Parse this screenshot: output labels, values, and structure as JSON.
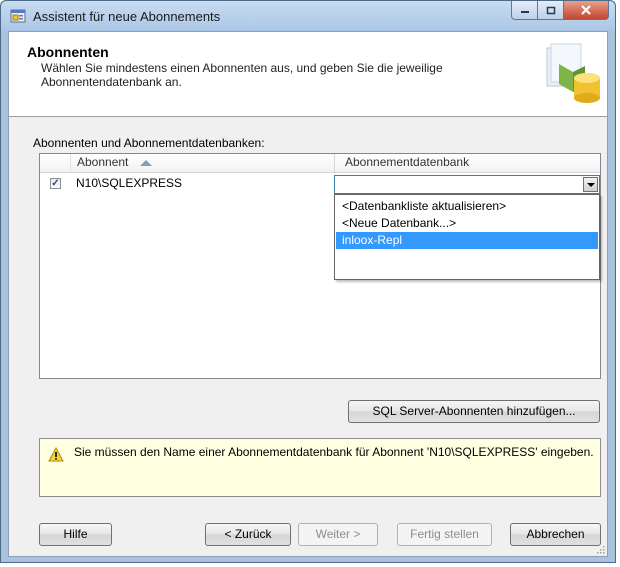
{
  "window": {
    "title": "Assistent für neue Abonnements"
  },
  "header": {
    "title": "Abonnenten",
    "description": "Wählen Sie mindestens einen Abonnenten aus, und geben Sie die jeweilige Abonnentendatenbank an."
  },
  "list": {
    "label": "Abonnenten und Abonnementdatenbanken:",
    "columns": {
      "abonnent": "Abonnent",
      "datenbank": "Abonnementdatenbank"
    },
    "rows": [
      {
        "checked": true,
        "abonnent": "N10\\SQLEXPRESS",
        "datenbank": ""
      }
    ],
    "dropdown_options": [
      "<Datenbankliste aktualisieren>",
      "<Neue Datenbank...>",
      "inloox-Repl"
    ],
    "dropdown_selected": "inloox-Repl"
  },
  "buttons": {
    "add_subscribers": "SQL Server-Abonnenten hinzufügen...",
    "help": "Hilfe",
    "back": "< Zurück",
    "next": "Weiter >",
    "finish": "Fertig stellen",
    "cancel": "Abbrechen"
  },
  "warning": {
    "text": "Sie müssen den Name einer Abonnementdatenbank für Abonnent 'N10\\SQLEXPRESS' eingeben."
  },
  "colors": {
    "selection": "#3399ff",
    "warning_bg": "#ffffe1"
  }
}
